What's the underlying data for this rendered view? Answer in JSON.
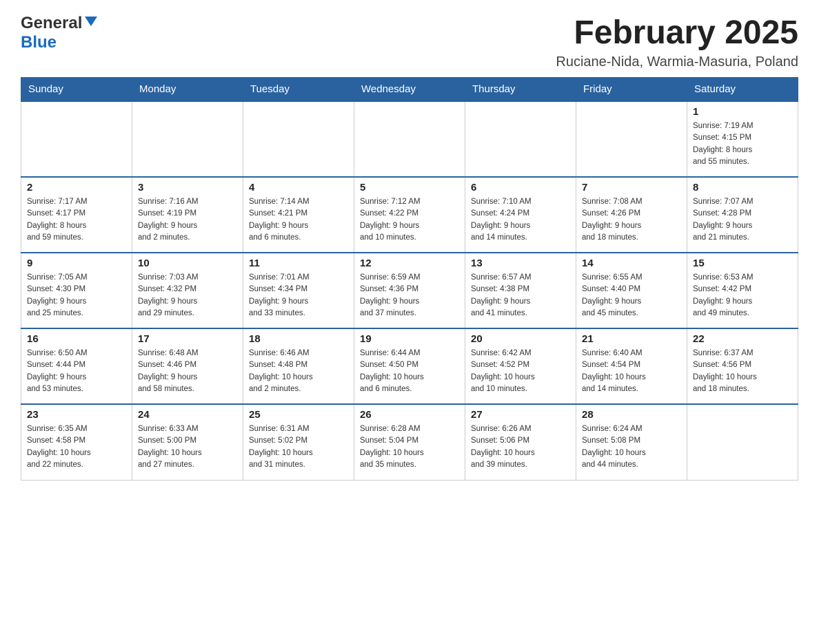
{
  "header": {
    "logo_general": "General",
    "logo_blue": "Blue",
    "month_title": "February 2025",
    "location": "Ruciane-Nida, Warmia-Masuria, Poland"
  },
  "weekdays": [
    "Sunday",
    "Monday",
    "Tuesday",
    "Wednesday",
    "Thursday",
    "Friday",
    "Saturday"
  ],
  "weeks": [
    [
      {
        "day": "",
        "info": ""
      },
      {
        "day": "",
        "info": ""
      },
      {
        "day": "",
        "info": ""
      },
      {
        "day": "",
        "info": ""
      },
      {
        "day": "",
        "info": ""
      },
      {
        "day": "",
        "info": ""
      },
      {
        "day": "1",
        "info": "Sunrise: 7:19 AM\nSunset: 4:15 PM\nDaylight: 8 hours\nand 55 minutes."
      }
    ],
    [
      {
        "day": "2",
        "info": "Sunrise: 7:17 AM\nSunset: 4:17 PM\nDaylight: 8 hours\nand 59 minutes."
      },
      {
        "day": "3",
        "info": "Sunrise: 7:16 AM\nSunset: 4:19 PM\nDaylight: 9 hours\nand 2 minutes."
      },
      {
        "day": "4",
        "info": "Sunrise: 7:14 AM\nSunset: 4:21 PM\nDaylight: 9 hours\nand 6 minutes."
      },
      {
        "day": "5",
        "info": "Sunrise: 7:12 AM\nSunset: 4:22 PM\nDaylight: 9 hours\nand 10 minutes."
      },
      {
        "day": "6",
        "info": "Sunrise: 7:10 AM\nSunset: 4:24 PM\nDaylight: 9 hours\nand 14 minutes."
      },
      {
        "day": "7",
        "info": "Sunrise: 7:08 AM\nSunset: 4:26 PM\nDaylight: 9 hours\nand 18 minutes."
      },
      {
        "day": "8",
        "info": "Sunrise: 7:07 AM\nSunset: 4:28 PM\nDaylight: 9 hours\nand 21 minutes."
      }
    ],
    [
      {
        "day": "9",
        "info": "Sunrise: 7:05 AM\nSunset: 4:30 PM\nDaylight: 9 hours\nand 25 minutes."
      },
      {
        "day": "10",
        "info": "Sunrise: 7:03 AM\nSunset: 4:32 PM\nDaylight: 9 hours\nand 29 minutes."
      },
      {
        "day": "11",
        "info": "Sunrise: 7:01 AM\nSunset: 4:34 PM\nDaylight: 9 hours\nand 33 minutes."
      },
      {
        "day": "12",
        "info": "Sunrise: 6:59 AM\nSunset: 4:36 PM\nDaylight: 9 hours\nand 37 minutes."
      },
      {
        "day": "13",
        "info": "Sunrise: 6:57 AM\nSunset: 4:38 PM\nDaylight: 9 hours\nand 41 minutes."
      },
      {
        "day": "14",
        "info": "Sunrise: 6:55 AM\nSunset: 4:40 PM\nDaylight: 9 hours\nand 45 minutes."
      },
      {
        "day": "15",
        "info": "Sunrise: 6:53 AM\nSunset: 4:42 PM\nDaylight: 9 hours\nand 49 minutes."
      }
    ],
    [
      {
        "day": "16",
        "info": "Sunrise: 6:50 AM\nSunset: 4:44 PM\nDaylight: 9 hours\nand 53 minutes."
      },
      {
        "day": "17",
        "info": "Sunrise: 6:48 AM\nSunset: 4:46 PM\nDaylight: 9 hours\nand 58 minutes."
      },
      {
        "day": "18",
        "info": "Sunrise: 6:46 AM\nSunset: 4:48 PM\nDaylight: 10 hours\nand 2 minutes."
      },
      {
        "day": "19",
        "info": "Sunrise: 6:44 AM\nSunset: 4:50 PM\nDaylight: 10 hours\nand 6 minutes."
      },
      {
        "day": "20",
        "info": "Sunrise: 6:42 AM\nSunset: 4:52 PM\nDaylight: 10 hours\nand 10 minutes."
      },
      {
        "day": "21",
        "info": "Sunrise: 6:40 AM\nSunset: 4:54 PM\nDaylight: 10 hours\nand 14 minutes."
      },
      {
        "day": "22",
        "info": "Sunrise: 6:37 AM\nSunset: 4:56 PM\nDaylight: 10 hours\nand 18 minutes."
      }
    ],
    [
      {
        "day": "23",
        "info": "Sunrise: 6:35 AM\nSunset: 4:58 PM\nDaylight: 10 hours\nand 22 minutes."
      },
      {
        "day": "24",
        "info": "Sunrise: 6:33 AM\nSunset: 5:00 PM\nDaylight: 10 hours\nand 27 minutes."
      },
      {
        "day": "25",
        "info": "Sunrise: 6:31 AM\nSunset: 5:02 PM\nDaylight: 10 hours\nand 31 minutes."
      },
      {
        "day": "26",
        "info": "Sunrise: 6:28 AM\nSunset: 5:04 PM\nDaylight: 10 hours\nand 35 minutes."
      },
      {
        "day": "27",
        "info": "Sunrise: 6:26 AM\nSunset: 5:06 PM\nDaylight: 10 hours\nand 39 minutes."
      },
      {
        "day": "28",
        "info": "Sunrise: 6:24 AM\nSunset: 5:08 PM\nDaylight: 10 hours\nand 44 minutes."
      },
      {
        "day": "",
        "info": ""
      }
    ]
  ]
}
